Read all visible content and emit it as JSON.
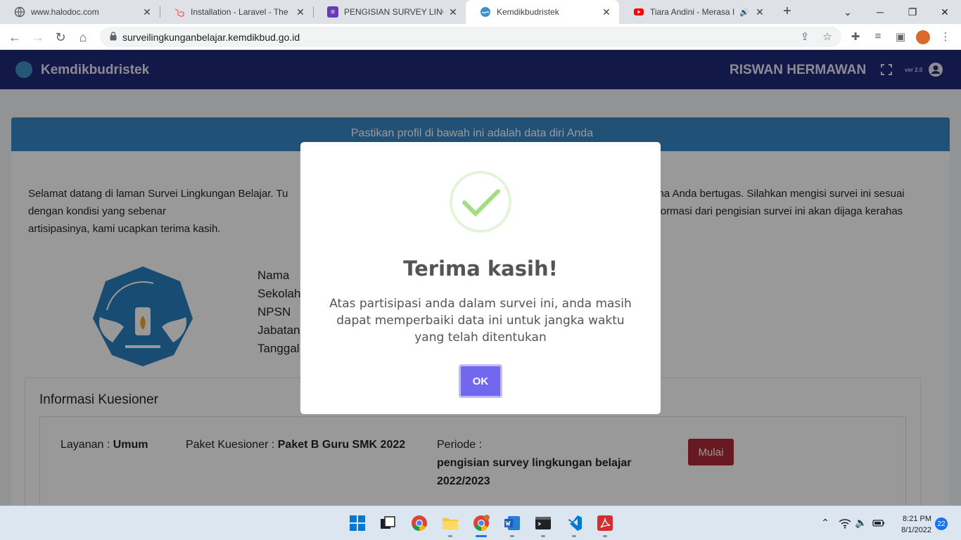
{
  "browser": {
    "tabs": [
      {
        "title": "www.halodoc.com",
        "icon": "globe-icon",
        "color": "#5f6368"
      },
      {
        "title": "Installation - Laravel - The PHP",
        "icon": "laravel-icon",
        "color": "#f4645f"
      },
      {
        "title": "PENGISIAN SURVEY LINGKUNGAN",
        "icon": "forms-icon",
        "color": "#673ab7"
      },
      {
        "title": "Kemdikbudristek",
        "icon": "kemdikbud-icon",
        "color": "#3f8fc9"
      },
      {
        "title": "Tiara Andini - Merasa Indah",
        "icon": "youtube-icon",
        "color": "#ff0000"
      }
    ],
    "url": "surveilingkunganbelajar.kemdikbud.go.id"
  },
  "navbar": {
    "brand": "Kemdikbudristek",
    "user": "RISWAN HERMAWAN",
    "version": "ver 2.0"
  },
  "card": {
    "header": "Pastikan profil di bawah ini adalah data diri Anda",
    "intro": "Selamat datang di laman Survei Lingkungan Belajar. Tu                                                                                          atuan pendidikan dimana Anda bertugas. Silahkan mengisi survei ini sesuai dengan kondisi yang sebenar                                                                                     n berpengaruh terhadap penilaian kinerja. Segala informasi dari pengisian survei ini akan dijaga kerahas                                                                                        artisipasinya, kami ucapkan terima kasih.",
    "profile_labels": [
      "Nama",
      "Sekolah",
      "NPSN",
      "Jabatan",
      "Tanggal"
    ]
  },
  "questionnaire": {
    "title": "Informasi Kuesioner",
    "layanan_label": "Layanan : ",
    "layanan_value": "Umum",
    "paket_label": "Paket Kuesioner : ",
    "paket_value": "Paket B Guru SMK 2022",
    "periode_label": "Periode :",
    "periode_value": "pengisian survey lingkungan belajar 2022/2023",
    "start_button": "Mulai"
  },
  "modal": {
    "title": "Terima kasih!",
    "text": "Atas partisipasi anda dalam survei ini, anda masih dapat memperbaiki data ini untuk jangka waktu yang telah ditentukan",
    "ok_button": "OK"
  },
  "taskbar": {
    "time": "8:21 PM",
    "date": "8/1/2022",
    "notifications": "22"
  },
  "colors": {
    "navbar": "#1f2a7b",
    "card_header": "#3a87c8",
    "ok_button": "#7267ef",
    "start_button": "#b02a37",
    "success": "#a5dc86"
  }
}
